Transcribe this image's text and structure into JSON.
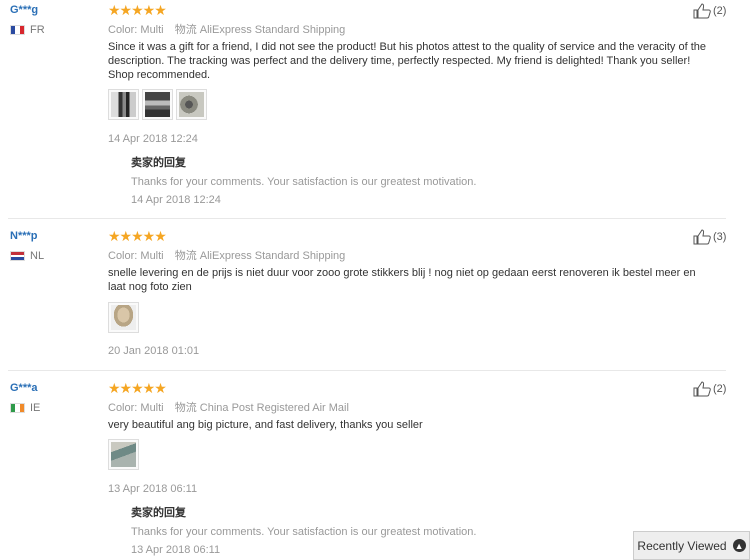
{
  "reviews": [
    {
      "user": "G***g",
      "country": "FR",
      "stars": "★★★★★",
      "color_key": "Color:",
      "color_val": "Multi",
      "shipping_key": "物流",
      "shipping_val": "AliExpress Standard Shipping",
      "text": "Since it was a gift for a friend, I did not see the product! But his photos attest to the quality of service and the veracity of the description. The tracking was perfect and the delivery time, perfectly respected. My friend is delighted! Thank you seller! Shop recommended.",
      "date": "14 Apr 2018 12:24",
      "likes": "(2)",
      "seller_header": "卖家的回复",
      "seller_msg": "Thanks for your comments. Your satisfaction is our greatest motivation.",
      "seller_date": "14 Apr 2018 12:24"
    },
    {
      "user": "N***p",
      "country": "NL",
      "stars": "★★★★★",
      "color_key": "Color:",
      "color_val": "Multi",
      "shipping_key": "物流",
      "shipping_val": "AliExpress Standard Shipping",
      "text": "snelle levering en de prijs is niet duur voor zooo grote stikkers blij ! nog niet op gedaan eerst renoveren ik bestel meer en laat nog foto zien",
      "date": "20 Jan 2018 01:01",
      "likes": "(3)"
    },
    {
      "user": "G***a",
      "country": "IE",
      "stars": "★★★★★",
      "color_key": "Color:",
      "color_val": "Multi",
      "shipping_key": "物流",
      "shipping_val": "China Post Registered Air Mail",
      "text": "very beautiful ang big picture, and fast delivery, thanks you seller",
      "date": "13 Apr 2018 06:11",
      "likes": "(2)",
      "seller_header": "卖家的回复",
      "seller_msg": "Thanks for your comments. Your satisfaction is our greatest motivation.",
      "seller_date": "13 Apr 2018 06:11"
    }
  ],
  "recently_viewed": "Recently Viewed",
  "colors": {
    "link": "#2a6fb6",
    "star": "#f5a623",
    "muted": "#999999"
  },
  "icons": {
    "like": "thumbs-up-icon",
    "recent": "chevron-up-icon"
  }
}
